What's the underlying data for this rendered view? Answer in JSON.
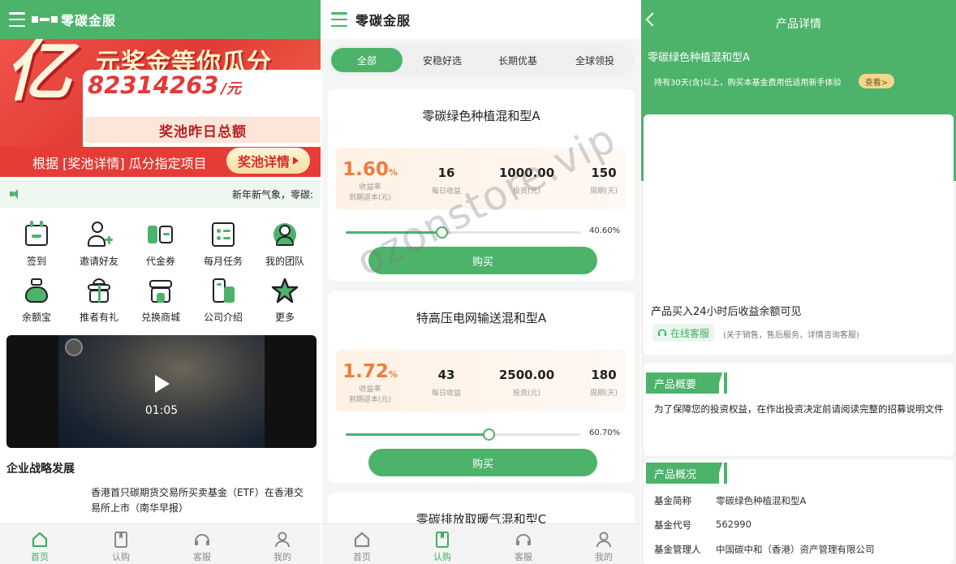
{
  "colors": {
    "brand_green": "#4db36b",
    "banner_red": "#e53c37",
    "rate_orange": "#f07c3c"
  },
  "home": {
    "brand": "零碳金服",
    "banner": {
      "yi": "亿",
      "headline": "元奖金等你瓜分",
      "amount": "82314263",
      "amount_unit": "/元",
      "pool_label": "奖池昨日总额",
      "rule": "根据 [奖池详情] 瓜分指定项目",
      "detail_button": "奖池详情"
    },
    "notice": "新年新气象，零碳:",
    "grid": [
      {
        "label": "签到",
        "icon": "calendar-check-icon"
      },
      {
        "label": "邀请好友",
        "icon": "user-add-icon"
      },
      {
        "label": "代金券",
        "icon": "voucher-icon"
      },
      {
        "label": "每月任务",
        "icon": "task-list-icon"
      },
      {
        "label": "我的团队",
        "icon": "team-icon"
      },
      {
        "label": "余额宝",
        "icon": "money-bag-icon"
      },
      {
        "label": "推者有礼",
        "icon": "gift-icon"
      },
      {
        "label": "兑换商城",
        "icon": "store-icon"
      },
      {
        "label": "公司介绍",
        "icon": "building-icon"
      },
      {
        "label": "更多",
        "icon": "star-icon"
      }
    ],
    "video_time": "01:05",
    "section_title": "企业战略发展",
    "news": "香港首只碳期货交易所买卖基金（ETF）在香港交易所上市（南华早报）"
  },
  "tabbar": [
    {
      "label": "首页",
      "icon": "home-icon"
    },
    {
      "label": "认购",
      "icon": "subscribe-icon"
    },
    {
      "label": "客服",
      "icon": "headset-icon"
    },
    {
      "label": "我的",
      "icon": "user-icon"
    }
  ],
  "products": {
    "brand": "零碳金服",
    "filters": [
      "全部",
      "安稳好选",
      "长期优基",
      "全球领投"
    ],
    "stat_labels": {
      "rate": "收益率",
      "rate_sub": "到期返本(元)",
      "daily": "每日收益",
      "invest": "投资(元)",
      "period": "周期(天)"
    },
    "buy_label": "购买",
    "items": [
      {
        "name": "零碳绿色种植混和型A",
        "rate": "1.60",
        "daily": "16",
        "invest": "1000.00",
        "period": "150",
        "progress": "40.60%",
        "progress_value": 40.6
      },
      {
        "name": "特高压电网输送混和型A",
        "rate": "1.72",
        "daily": "43",
        "invest": "2500.00",
        "period": "180",
        "progress": "60.70%",
        "progress_value": 60.7
      },
      {
        "name": "零碳排放取暖气混和型C"
      }
    ],
    "rate_unit": "%"
  },
  "detail": {
    "title": "产品详情",
    "product_name": "零碳绿色种植混和型A",
    "tip": "持有30天(含)以上，购买本基金费用低适用新手体验",
    "view_button": "查看>",
    "visible_note": "产品买入24小时后收益余额可见",
    "service_button": "在线客服",
    "service_note": "(关于销售，售后服务，详情咨询客服)",
    "overview_title": "产品概要",
    "overview_text": "为了保障您的投资权益，在作出投资决定前请阅读完整的招募说明文件",
    "summary_title": "产品概况",
    "fields": [
      {
        "k": "基金简称",
        "v": "零碳绿色种植混和型A"
      },
      {
        "k": "基金代号",
        "v": "562990"
      },
      {
        "k": "基金管理人",
        "v": "中国碳中和（香港）资产管理有限公司"
      }
    ]
  },
  "watermark": "ozonstore.vip"
}
